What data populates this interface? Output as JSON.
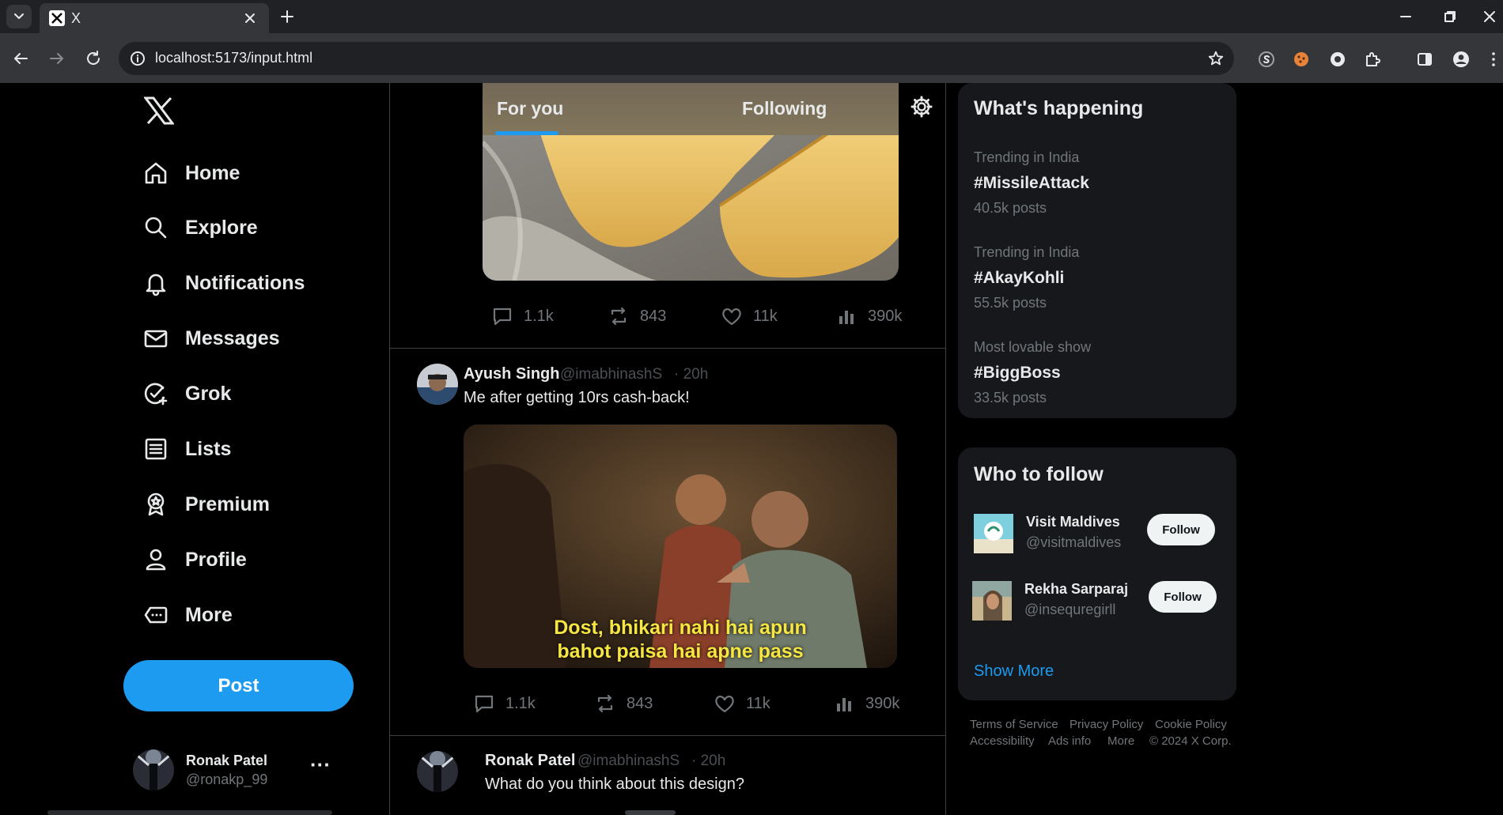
{
  "browser": {
    "tab_title": "X",
    "address": "localhost:5173/input.html"
  },
  "sidebar": {
    "nav": [
      {
        "label": "Home",
        "icon": "home-icon"
      },
      {
        "label": "Explore",
        "icon": "search-icon"
      },
      {
        "label": "Notifications",
        "icon": "bell-icon"
      },
      {
        "label": "Messages",
        "icon": "envelope-icon"
      },
      {
        "label": "Grok",
        "icon": "grok-icon"
      },
      {
        "label": "Lists",
        "icon": "list-icon"
      },
      {
        "label": "Premium",
        "icon": "premium-icon"
      },
      {
        "label": "Profile",
        "icon": "person-icon"
      },
      {
        "label": "More",
        "icon": "more-icon"
      }
    ],
    "post_button": "Post",
    "account": {
      "name": "Ronak Patel",
      "handle": "@ronakp_99",
      "more": "···"
    }
  },
  "feed": {
    "tabs": [
      "For you",
      "Following"
    ],
    "active_tab": "For you",
    "posts": [
      {
        "actions": {
          "replies": "1.1k",
          "reposts": "843",
          "likes": "11k",
          "views": "390k"
        }
      },
      {
        "name": "Ayush Singh",
        "handle": "@imabhinashS",
        "time": "· 20h",
        "text": "Me after getting 10rs cash-back!",
        "image_caption_line1": "Dost, bhikari nahi hai apun",
        "image_caption_line2": "bahot paisa hai apne pass",
        "actions": {
          "replies": "1.1k",
          "reposts": "843",
          "likes": "11k",
          "views": "390k"
        }
      },
      {
        "name": "Ronak Patel",
        "handle": "@imabhinashS",
        "time": "· 20h",
        "text": "What do you think about this design?"
      }
    ]
  },
  "right": {
    "happening_title": "What's happening",
    "trends": [
      {
        "category": "Trending in India",
        "tag": "#MissileAttack",
        "count": "40.5k posts"
      },
      {
        "category": "Trending in India",
        "tag": "#AkayKohli",
        "count": "55.5k posts"
      },
      {
        "category": "Most lovable show",
        "tag": "#BiggBoss",
        "count": "33.5k posts"
      }
    ],
    "who_title": "Who to follow",
    "suggestions": [
      {
        "name": "Visit Maldives",
        "handle": "@visitmaldives",
        "button": "Follow"
      },
      {
        "name": "Rekha Sarparaj",
        "handle": "@insequregirll",
        "button": "Follow"
      }
    ],
    "show_more": "Show More",
    "footer": {
      "row1": [
        "Terms of Service",
        "Privacy Policy",
        "Cookie Policy"
      ],
      "row2": [
        "Accessibility",
        "Ads info",
        "More",
        "© 2024 X Corp."
      ]
    }
  },
  "colors": {
    "accent": "#1d9bf0",
    "link": "#1d9bf0",
    "caption": "#f5e642"
  }
}
